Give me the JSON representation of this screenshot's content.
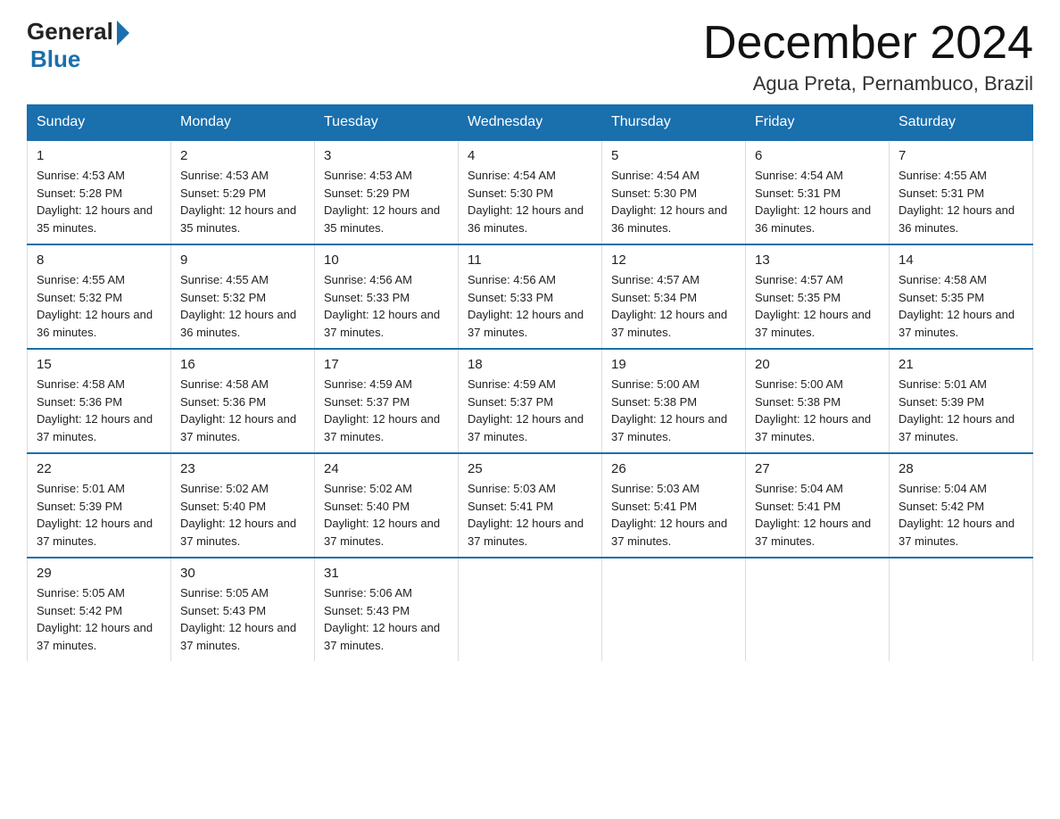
{
  "logo": {
    "general": "General",
    "blue": "Blue"
  },
  "title": "December 2024",
  "location": "Agua Preta, Pernambuco, Brazil",
  "headers": [
    "Sunday",
    "Monday",
    "Tuesday",
    "Wednesday",
    "Thursday",
    "Friday",
    "Saturday"
  ],
  "weeks": [
    [
      {
        "day": "1",
        "sunrise": "4:53 AM",
        "sunset": "5:28 PM",
        "daylight": "12 hours and 35 minutes."
      },
      {
        "day": "2",
        "sunrise": "4:53 AM",
        "sunset": "5:29 PM",
        "daylight": "12 hours and 35 minutes."
      },
      {
        "day": "3",
        "sunrise": "4:53 AM",
        "sunset": "5:29 PM",
        "daylight": "12 hours and 35 minutes."
      },
      {
        "day": "4",
        "sunrise": "4:54 AM",
        "sunset": "5:30 PM",
        "daylight": "12 hours and 36 minutes."
      },
      {
        "day": "5",
        "sunrise": "4:54 AM",
        "sunset": "5:30 PM",
        "daylight": "12 hours and 36 minutes."
      },
      {
        "day": "6",
        "sunrise": "4:54 AM",
        "sunset": "5:31 PM",
        "daylight": "12 hours and 36 minutes."
      },
      {
        "day": "7",
        "sunrise": "4:55 AM",
        "sunset": "5:31 PM",
        "daylight": "12 hours and 36 minutes."
      }
    ],
    [
      {
        "day": "8",
        "sunrise": "4:55 AM",
        "sunset": "5:32 PM",
        "daylight": "12 hours and 36 minutes."
      },
      {
        "day": "9",
        "sunrise": "4:55 AM",
        "sunset": "5:32 PM",
        "daylight": "12 hours and 36 minutes."
      },
      {
        "day": "10",
        "sunrise": "4:56 AM",
        "sunset": "5:33 PM",
        "daylight": "12 hours and 37 minutes."
      },
      {
        "day": "11",
        "sunrise": "4:56 AM",
        "sunset": "5:33 PM",
        "daylight": "12 hours and 37 minutes."
      },
      {
        "day": "12",
        "sunrise": "4:57 AM",
        "sunset": "5:34 PM",
        "daylight": "12 hours and 37 minutes."
      },
      {
        "day": "13",
        "sunrise": "4:57 AM",
        "sunset": "5:35 PM",
        "daylight": "12 hours and 37 minutes."
      },
      {
        "day": "14",
        "sunrise": "4:58 AM",
        "sunset": "5:35 PM",
        "daylight": "12 hours and 37 minutes."
      }
    ],
    [
      {
        "day": "15",
        "sunrise": "4:58 AM",
        "sunset": "5:36 PM",
        "daylight": "12 hours and 37 minutes."
      },
      {
        "day": "16",
        "sunrise": "4:58 AM",
        "sunset": "5:36 PM",
        "daylight": "12 hours and 37 minutes."
      },
      {
        "day": "17",
        "sunrise": "4:59 AM",
        "sunset": "5:37 PM",
        "daylight": "12 hours and 37 minutes."
      },
      {
        "day": "18",
        "sunrise": "4:59 AM",
        "sunset": "5:37 PM",
        "daylight": "12 hours and 37 minutes."
      },
      {
        "day": "19",
        "sunrise": "5:00 AM",
        "sunset": "5:38 PM",
        "daylight": "12 hours and 37 minutes."
      },
      {
        "day": "20",
        "sunrise": "5:00 AM",
        "sunset": "5:38 PM",
        "daylight": "12 hours and 37 minutes."
      },
      {
        "day": "21",
        "sunrise": "5:01 AM",
        "sunset": "5:39 PM",
        "daylight": "12 hours and 37 minutes."
      }
    ],
    [
      {
        "day": "22",
        "sunrise": "5:01 AM",
        "sunset": "5:39 PM",
        "daylight": "12 hours and 37 minutes."
      },
      {
        "day": "23",
        "sunrise": "5:02 AM",
        "sunset": "5:40 PM",
        "daylight": "12 hours and 37 minutes."
      },
      {
        "day": "24",
        "sunrise": "5:02 AM",
        "sunset": "5:40 PM",
        "daylight": "12 hours and 37 minutes."
      },
      {
        "day": "25",
        "sunrise": "5:03 AM",
        "sunset": "5:41 PM",
        "daylight": "12 hours and 37 minutes."
      },
      {
        "day": "26",
        "sunrise": "5:03 AM",
        "sunset": "5:41 PM",
        "daylight": "12 hours and 37 minutes."
      },
      {
        "day": "27",
        "sunrise": "5:04 AM",
        "sunset": "5:41 PM",
        "daylight": "12 hours and 37 minutes."
      },
      {
        "day": "28",
        "sunrise": "5:04 AM",
        "sunset": "5:42 PM",
        "daylight": "12 hours and 37 minutes."
      }
    ],
    [
      {
        "day": "29",
        "sunrise": "5:05 AM",
        "sunset": "5:42 PM",
        "daylight": "12 hours and 37 minutes."
      },
      {
        "day": "30",
        "sunrise": "5:05 AM",
        "sunset": "5:43 PM",
        "daylight": "12 hours and 37 minutes."
      },
      {
        "day": "31",
        "sunrise": "5:06 AM",
        "sunset": "5:43 PM",
        "daylight": "12 hours and 37 minutes."
      },
      null,
      null,
      null,
      null
    ]
  ]
}
